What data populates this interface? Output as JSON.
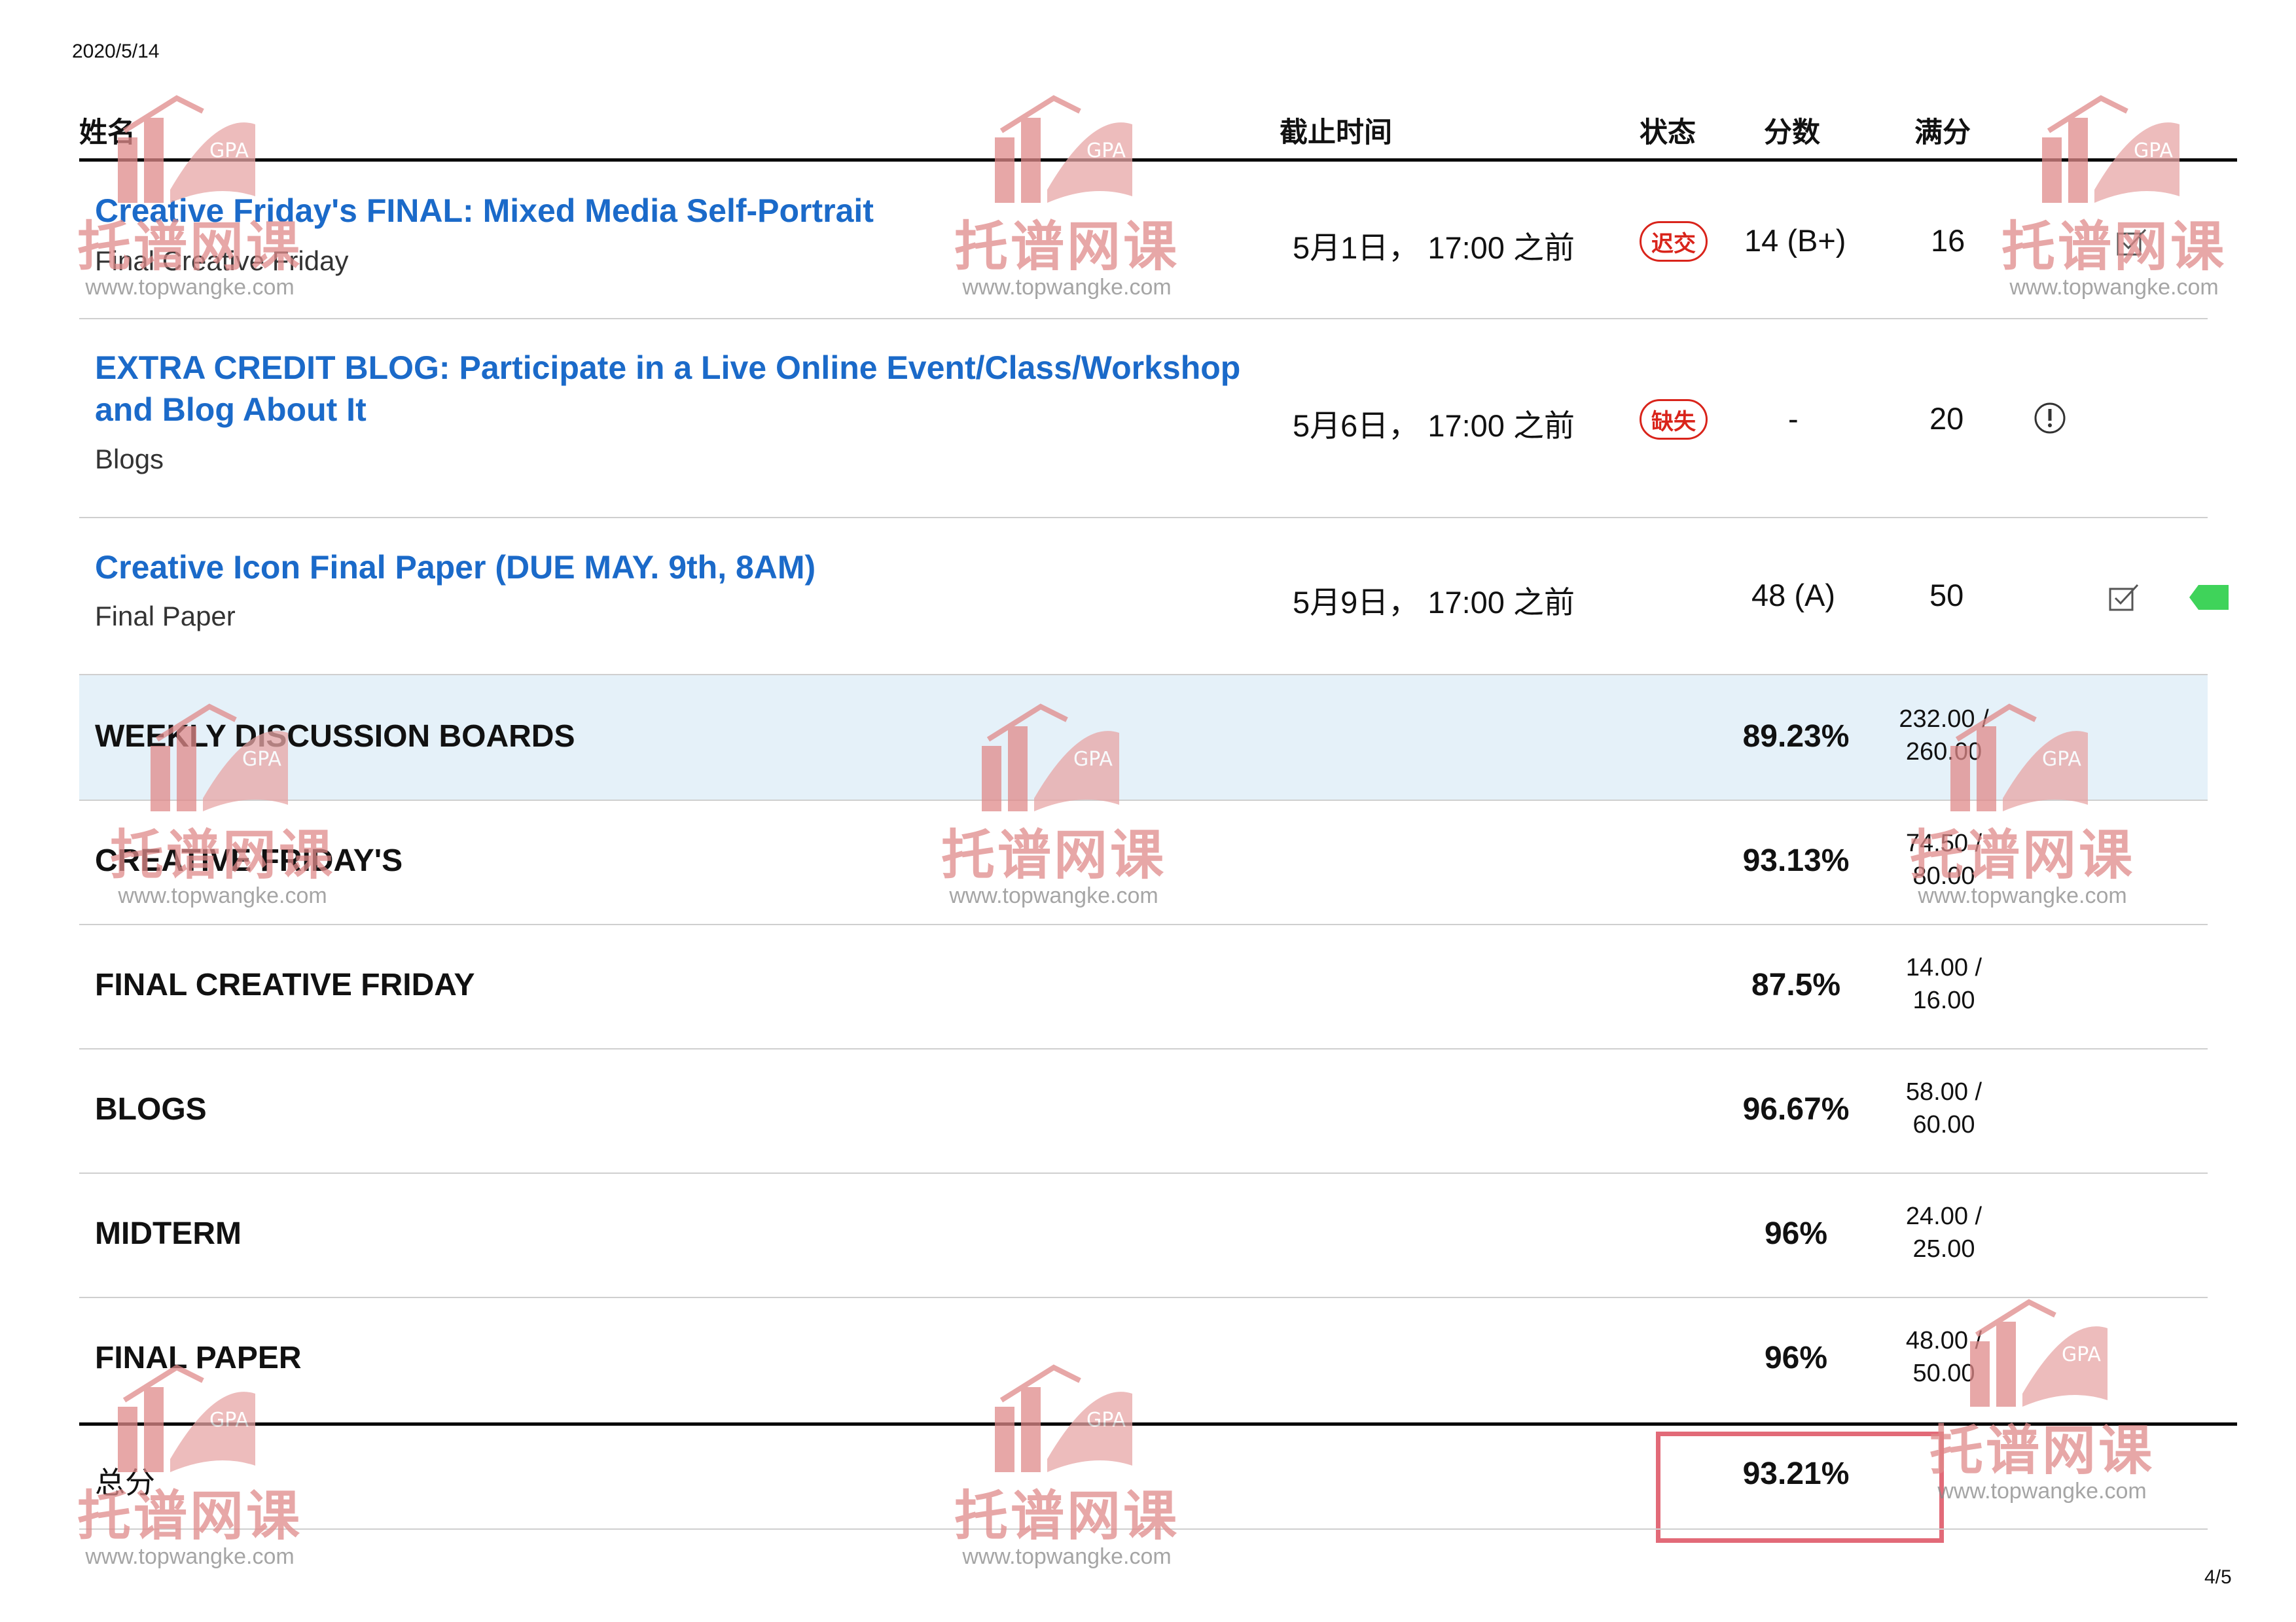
{
  "page": {
    "date": "2020/5/14",
    "page_number": "4/5"
  },
  "columns": {
    "name": "姓名",
    "due": "截止时间",
    "status": "状态",
    "score": "分数",
    "out_of": "满分"
  },
  "assignments": [
    {
      "title": "Creative Friday's FINAL: Mixed Media Self-Portrait",
      "category": "Final Creative Friday",
      "due": "5月1日， 17:00 之前",
      "status": "迟交",
      "score": "14 (B+)",
      "out_of": "16"
    },
    {
      "title_line1": "EXTRA CREDIT BLOG: Participate in a Live Online Event/Class/Workshop",
      "title_line2": "and Blog About It",
      "category": "Blogs",
      "due": "5月6日， 17:00 之前",
      "status": "缺失",
      "score": "-",
      "out_of": "20"
    },
    {
      "title": "Creative Icon Final Paper (DUE MAY. 9th, 8AM)",
      "category": "Final Paper",
      "due": "5月9日， 17:00 之前",
      "status": "",
      "score": "48 (A)",
      "out_of": "50"
    }
  ],
  "groups": [
    {
      "name": "WEEKLY DISCUSSION BOARDS",
      "percent": "89.23%",
      "points": "232.00 /",
      "total": "260.00"
    },
    {
      "name": "CREATIVE FRIDAY'S",
      "percent": "93.13%",
      "points": "74.50 /",
      "total": "80.00"
    },
    {
      "name": "FINAL CREATIVE FRIDAY",
      "percent": "87.5%",
      "points": "14.00 /",
      "total": "16.00"
    },
    {
      "name": "BLOGS",
      "percent": "96.67%",
      "points": "58.00 /",
      "total": "60.00"
    },
    {
      "name": "MIDTERM",
      "percent": "96%",
      "points": "24.00 /",
      "total": "25.00"
    },
    {
      "name": "FINAL PAPER",
      "percent": "96%",
      "points": "48.00 /",
      "total": "50.00"
    }
  ],
  "total": {
    "label": "总分",
    "percent": "93.21%"
  },
  "watermark": {
    "brand": "托谱网课",
    "url": "www.topwangke.com",
    "badge": "GPA"
  },
  "colors": {
    "link": "#1b6ac9",
    "late": "#d9241b",
    "highlight_row": "#e5f1f9",
    "total_box": "#e26a78",
    "watermark": "#e08a8a"
  }
}
